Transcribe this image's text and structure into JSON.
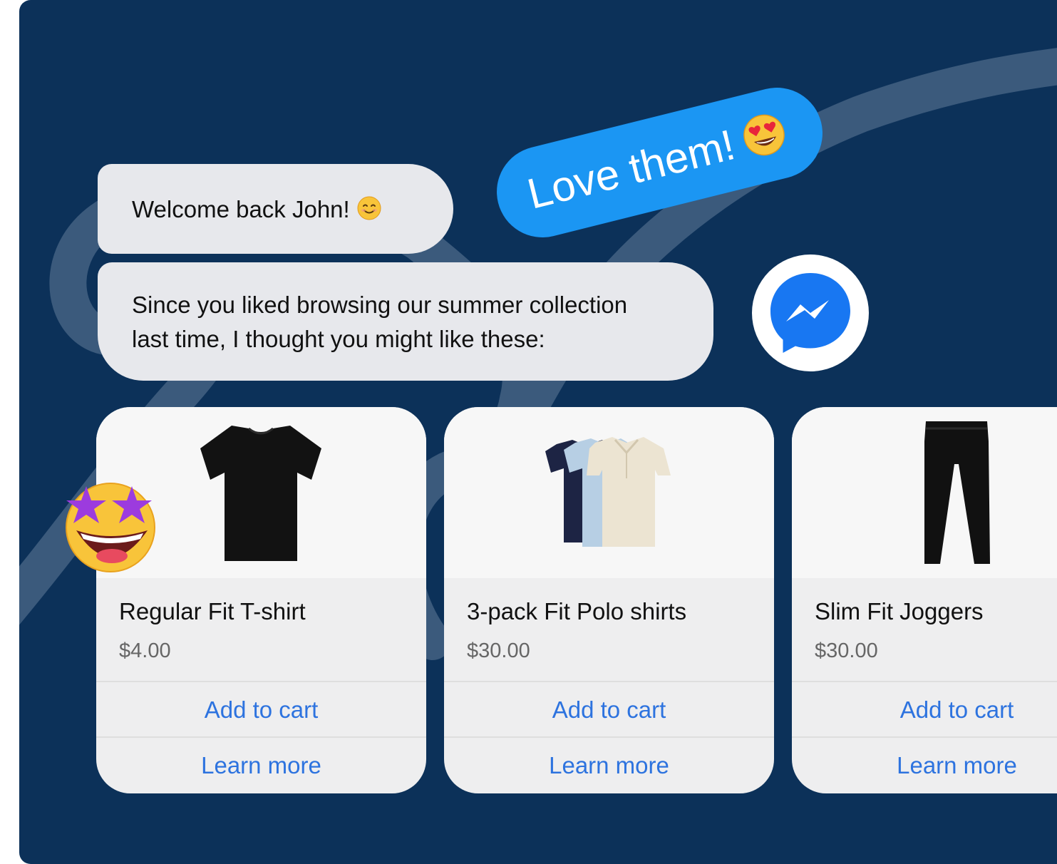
{
  "colors": {
    "background": "#0c3159",
    "incoming_bubble": "#e7e8ec",
    "outgoing_bubble": "#1b96f3",
    "link": "#2d73df",
    "messenger_blue": "#1877f2"
  },
  "chat": {
    "welcome_text": "Welcome back John!",
    "welcome_emoji": "smiling-face-icon",
    "recommendation_line1": "Since you liked browsing our summer collection",
    "recommendation_line2": "last time, I thought you might like these:",
    "reply_text": "Love them!",
    "reply_emoji": "heart-eyes-icon"
  },
  "channel_icon": "messenger-icon",
  "decoration_emoji": "star-struck-icon",
  "products": [
    {
      "image": "black-tshirt-image",
      "title": "Regular Fit T-shirt",
      "price": "$4.00",
      "add_label": "Add to cart",
      "learn_label": "Learn more"
    },
    {
      "image": "polo-shirts-image",
      "title": "3-pack Fit Polo shirts",
      "price": "$30.00",
      "add_label": "Add to cart",
      "learn_label": "Learn more"
    },
    {
      "image": "joggers-image",
      "title": "Slim Fit Joggers",
      "price": "$30.00",
      "add_label": "Add to cart",
      "learn_label": "Learn more"
    }
  ]
}
